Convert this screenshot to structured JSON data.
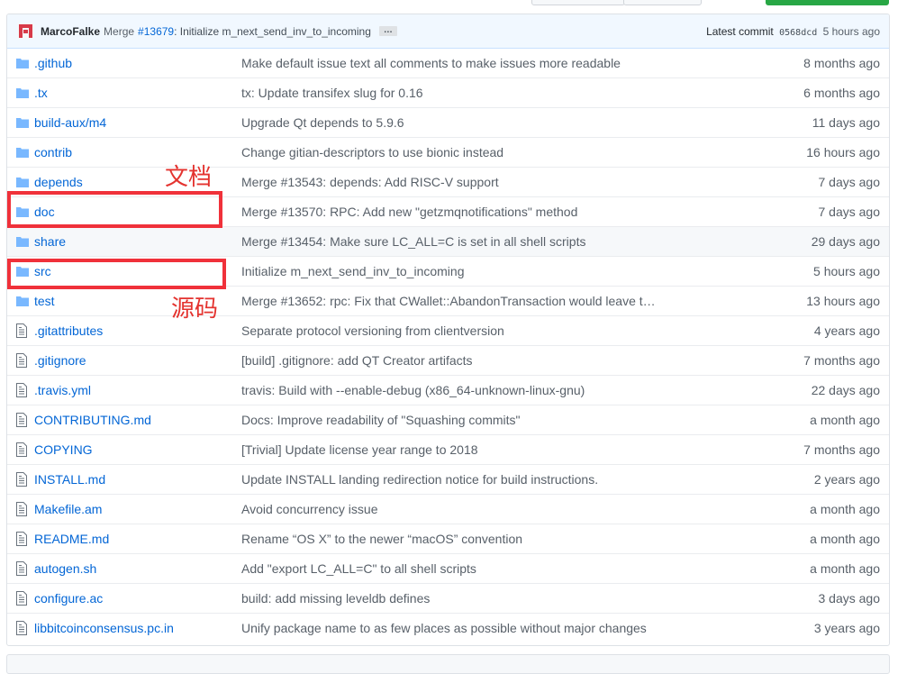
{
  "commit": {
    "author": "MarcoFalke",
    "merge_text": "Merge",
    "pr": "#13679",
    "message": ": Initialize m_next_send_inv_to_incoming",
    "ellipsis": "…",
    "latest_label": "Latest commit",
    "sha": "0568dcd",
    "age": "5 hours ago"
  },
  "files": [
    {
      "type": "dir",
      "name": ".github",
      "message": "Make default issue text all comments to make issues more readable",
      "age": "8 months ago"
    },
    {
      "type": "dir",
      "name": ".tx",
      "message": "tx: Update transifex slug for 0.16",
      "age": "6 months ago"
    },
    {
      "type": "dir",
      "name": "build-aux/m4",
      "message": "Upgrade Qt depends to 5.9.6",
      "age": "11 days ago"
    },
    {
      "type": "dir",
      "name": "contrib",
      "message": "Change gitian-descriptors to use bionic instead",
      "age": "16 hours ago"
    },
    {
      "type": "dir",
      "name": "depends",
      "message": "Merge #13543: depends: Add RISC-V support",
      "age": "7 days ago"
    },
    {
      "type": "dir",
      "name": "doc",
      "message": "Merge #13570: RPC: Add new \"getzmqnotifications\" method",
      "age": "7 days ago"
    },
    {
      "type": "dir",
      "name": "share",
      "message": "Merge #13454: Make sure LC_ALL=C is set in all shell scripts",
      "age": "29 days ago"
    },
    {
      "type": "dir",
      "name": "src",
      "message": "Initialize m_next_send_inv_to_incoming",
      "age": "5 hours ago"
    },
    {
      "type": "dir",
      "name": "test",
      "message": "Merge #13652: rpc: Fix that CWallet::AbandonTransaction would leave t…",
      "age": "13 hours ago"
    },
    {
      "type": "file",
      "name": ".gitattributes",
      "message": "Separate protocol versioning from clientversion",
      "age": "4 years ago"
    },
    {
      "type": "file",
      "name": ".gitignore",
      "message": "[build] .gitignore: add QT Creator artifacts",
      "age": "7 months ago"
    },
    {
      "type": "file",
      "name": ".travis.yml",
      "message": "travis: Build with --enable-debug (x86_64-unknown-linux-gnu)",
      "age": "22 days ago"
    },
    {
      "type": "file",
      "name": "CONTRIBUTING.md",
      "message": "Docs: Improve readability of \"Squashing commits\"",
      "age": "a month ago"
    },
    {
      "type": "file",
      "name": "COPYING",
      "message": "[Trivial] Update license year range to 2018",
      "age": "7 months ago"
    },
    {
      "type": "file",
      "name": "INSTALL.md",
      "message": "Update INSTALL landing redirection notice for build instructions.",
      "age": "2 years ago"
    },
    {
      "type": "file",
      "name": "Makefile.am",
      "message": "Avoid concurrency issue",
      "age": "a month ago"
    },
    {
      "type": "file",
      "name": "README.md",
      "message": "Rename “OS X” to the newer “macOS” convention",
      "age": "a month ago"
    },
    {
      "type": "file",
      "name": "autogen.sh",
      "message": "Add \"export LC_ALL=C\" to all shell scripts",
      "age": "a month ago"
    },
    {
      "type": "file",
      "name": "configure.ac",
      "message": "build: add missing leveldb defines",
      "age": "3 days ago"
    },
    {
      "type": "file",
      "name": "libbitcoinconsensus.pc.in",
      "message": "Unify package name to as few places as possible without major changes",
      "age": "3 years ago"
    }
  ],
  "annotations": {
    "doc_label": "文档",
    "src_label": "源码"
  },
  "colors": {
    "link": "#0366d6",
    "annotation": "#e4332f",
    "folder": "#79b8ff"
  },
  "icons": {
    "dir": "folder-icon",
    "file": "file-icon"
  }
}
